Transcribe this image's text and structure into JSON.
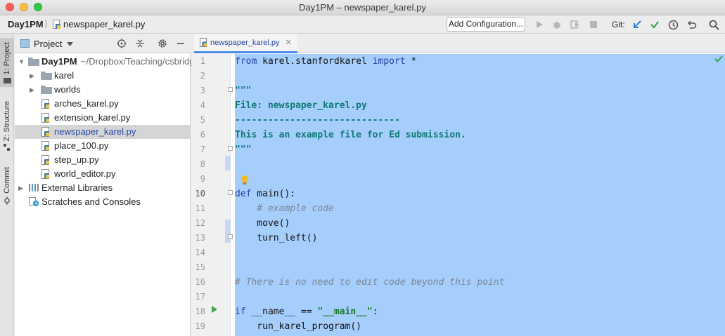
{
  "window": {
    "title": "Day1PM – newspaper_karel.py"
  },
  "breadcrumb": {
    "root": "Day1PM",
    "file": "newspaper_karel.py"
  },
  "toolbar": {
    "add_configuration": "Add Configuration...",
    "git_label": "Git:"
  },
  "side_tabs": {
    "project": "1: Project",
    "structure": "Z: Structure",
    "commit": "Commit"
  },
  "project_panel": {
    "title": "Project",
    "root_name": "Day1PM",
    "root_path": "~/Dropbox/Teaching/csbridge",
    "items": [
      {
        "label": "karel",
        "kind": "folder"
      },
      {
        "label": "worlds",
        "kind": "folder"
      },
      {
        "label": "arches_karel.py",
        "kind": "python-file"
      },
      {
        "label": "extension_karel.py",
        "kind": "python-file"
      },
      {
        "label": "newspaper_karel.py",
        "kind": "python-file",
        "selected": true
      },
      {
        "label": "place_100.py",
        "kind": "python-file"
      },
      {
        "label": "step_up.py",
        "kind": "python-file"
      },
      {
        "label": "world_editor.py",
        "kind": "python-file"
      }
    ],
    "external_libraries": "External Libraries",
    "scratches": "Scratches and Consoles"
  },
  "editor": {
    "tab_label": "newspaper_karel.py",
    "line_numbers": [
      "1",
      "2",
      "3",
      "4",
      "5",
      "6",
      "7",
      "8",
      "9",
      "10",
      "11",
      "12",
      "13",
      "14",
      "15",
      "16",
      "17",
      "18",
      "19"
    ],
    "lines": {
      "l1_from": "from",
      "l1_mod": " karel.stanfordkarel ",
      "l1_import": "import",
      "l1_star": " *",
      "l3": "\"\"\"",
      "l4": "File: newspaper_karel.py",
      "l5": "------------------------------",
      "l6": "This is an example file for Ed submission.",
      "l7": "\"\"\"",
      "l10_def": "def",
      "l10_rest": " main():",
      "l11": "    # example code",
      "l12": "    move()",
      "l13": "    turn_left()",
      "l16": "# There is no need to edit code beyond this point",
      "l18_if": "if",
      "l18_mid": " __name__ == ",
      "l18_str": "\"__main__\"",
      "l18_end": ":",
      "l19": "    run_karel_program()"
    }
  },
  "colors": {
    "selection": "#a6cefc",
    "accent": "#4d8be8",
    "keyword": "#1f3fa6",
    "docstring": "#0f7b74"
  }
}
